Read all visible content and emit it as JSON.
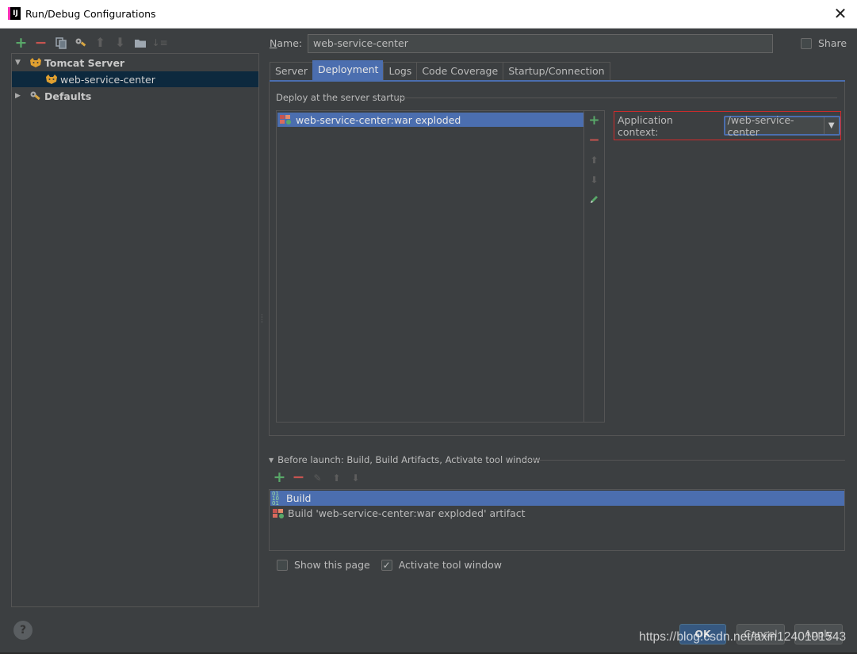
{
  "window": {
    "title": "Run/Debug Configurations",
    "close_glyph": "✕"
  },
  "left_toolbar": {
    "icons": [
      "add-icon",
      "remove-icon",
      "copy-icon",
      "edit-defaults-icon",
      "move-up-icon",
      "move-down-icon",
      "folder-icon",
      "sort-icon"
    ]
  },
  "tree": {
    "groups": [
      {
        "label": "Tomcat Server",
        "expanded": true,
        "children": [
          {
            "label": "web-service-center",
            "selected": true
          }
        ]
      },
      {
        "label": "Defaults",
        "expanded": false
      }
    ]
  },
  "name": {
    "label_mnemonic": "N",
    "label_rest": "ame:",
    "value": "web-service-center"
  },
  "share": {
    "label": "Share",
    "checked": false
  },
  "tabs": [
    {
      "label": "Server",
      "active": false
    },
    {
      "label": "Deployment",
      "active": true
    },
    {
      "label": "Logs",
      "active": false
    },
    {
      "label": "Code Coverage",
      "active": false
    },
    {
      "label": "Startup/Connection",
      "active": false
    }
  ],
  "deployment": {
    "section_title": "Deploy at the server startup",
    "artifacts": [
      {
        "label": "web-service-center:war exploded",
        "selected": true
      }
    ],
    "application_context": {
      "label": "Application context:",
      "value": "/web-service-center"
    }
  },
  "before_launch": {
    "title": "Before launch: Build, Build Artifacts, Activate tool window",
    "items": [
      {
        "label": "Build",
        "selected": true
      },
      {
        "label": "Build 'web-service-center:war exploded' artifact",
        "selected": false
      }
    ]
  },
  "options": {
    "show_this_page": {
      "label": "Show this page",
      "checked": false
    },
    "activate_tool_window": {
      "label": "Activate tool window",
      "checked": true
    }
  },
  "buttons": {
    "help": "?",
    "ok": "OK",
    "cancel": "Cancel",
    "apply": "Apply"
  },
  "watermark": "https://blog.csdn.net/axin1240101543",
  "colors": {
    "accent": "#4b6eaf",
    "background": "#3c3f41",
    "highlight_border": "#d02b2b",
    "add": "#59a869",
    "remove": "#c75450"
  }
}
